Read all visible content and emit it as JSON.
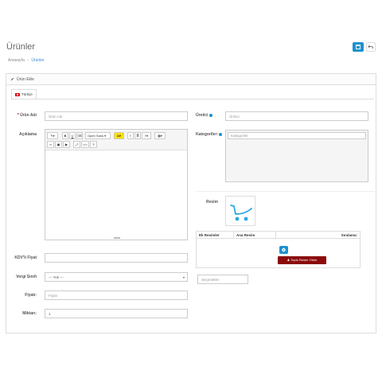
{
  "header": {
    "title": "Ürünler",
    "breadcrumb": [
      {
        "label": "Anasayfa"
      },
      {
        "label": "Ürünler"
      }
    ],
    "save_icon": "save-icon",
    "back_icon": "back-arrow-icon",
    "accent_color": "#1e91cf"
  },
  "panel": {
    "title": "Ürün Ekle",
    "tab_label": "Türkçe"
  },
  "form": {
    "product_name_label": "Ürün Adı",
    "product_name_placeholder": "Ürün Adı",
    "description_label": "Açıklama",
    "font_select": "Open Sans",
    "vat_price_label": "KDV'li Fiyat",
    "tax_class_label": "Vergi Sınıfı",
    "tax_class_value": "--- Yok ---",
    "price_label": "Fiyatı:",
    "price_placeholder": "Fiyatı",
    "quantity_label": "Miktarı:",
    "quantity_value": "1",
    "manufacturer_label": "Üretici",
    "manufacturer_placeholder": "Üretici",
    "categories_label": "Kategoriler:",
    "categories_placeholder": "Kategoriler",
    "image_label": "Resim",
    "images_table": {
      "col1": "Ek Resimler",
      "col2": "Ana Resim",
      "col3": "Sıralama:",
      "bulk_upload_label": "Toplu Resim Yükle"
    },
    "options_placeholder": "Seçenekler"
  }
}
